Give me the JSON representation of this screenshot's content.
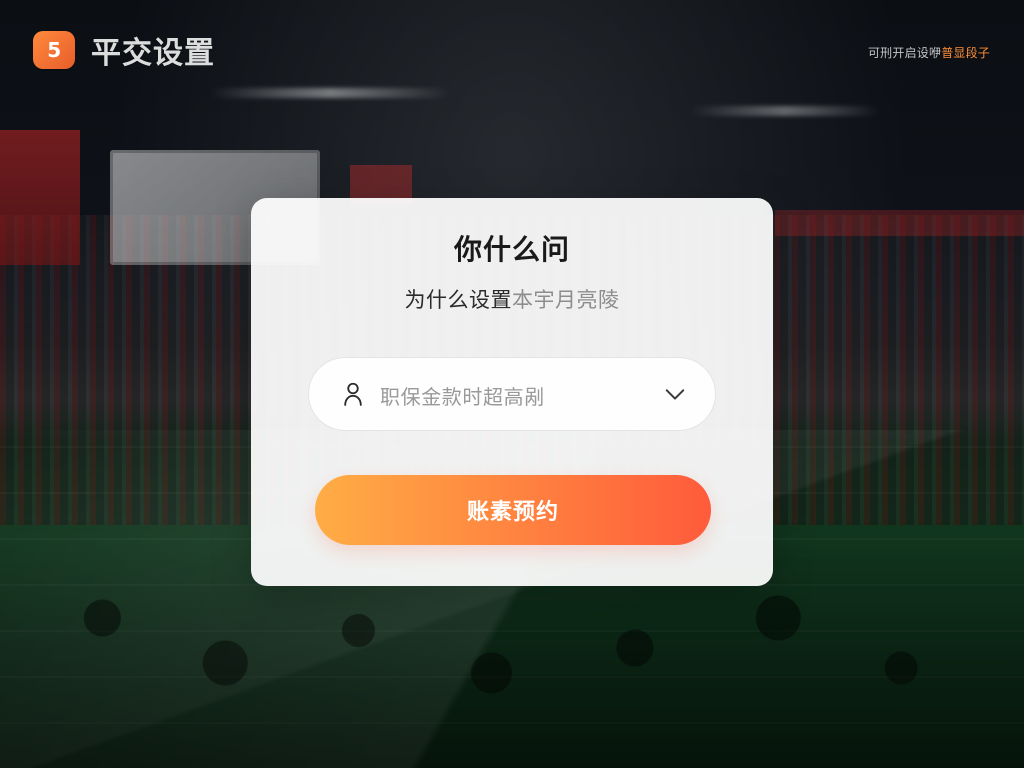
{
  "app": {
    "logo_text": "5",
    "title": "平交设置"
  },
  "header": {
    "right_hint_prefix": "可刑开启设咿",
    "right_hint_accent": "普显段子"
  },
  "dialog": {
    "title": "你什么问",
    "subtitle_strong": "为什么设置",
    "subtitle_faded": "本宇月亮陵"
  },
  "select": {
    "value": "职保金款时超高剐",
    "icon": "user-icon",
    "chevron_icon": "chevron-down-icon"
  },
  "primary_button": {
    "label": "账素预约"
  },
  "colors": {
    "brand_orange": "#ff8a3d",
    "brand_red": "#e85d2a",
    "button_left": "#ffad45",
    "button_right": "#ff5b3b",
    "accent_hint": "#ff8f3b"
  }
}
